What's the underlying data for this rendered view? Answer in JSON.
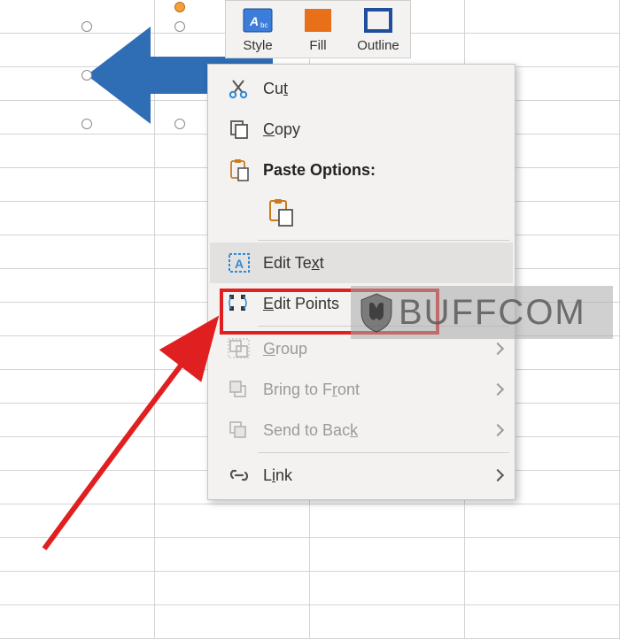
{
  "miniToolbar": {
    "style": "Style",
    "fill": "Fill",
    "outline": "Outline"
  },
  "contextMenu": {
    "cut": "Cut",
    "copy": "Copy",
    "pasteOptionsHeader": "Paste Options:",
    "editText": "Edit Text",
    "editPoints": "Edit Points",
    "group": "Group",
    "bringToFront": "Bring to Front",
    "sendToBack": "Send to Back",
    "link": "Link"
  },
  "watermark": {
    "text": "BUFFCOM"
  },
  "colors": {
    "shapeFill": "#2f6db5",
    "fillSwatch": "#e8701a",
    "outlineSwatch": "#1f4e9c",
    "highlight": "#e02020"
  }
}
